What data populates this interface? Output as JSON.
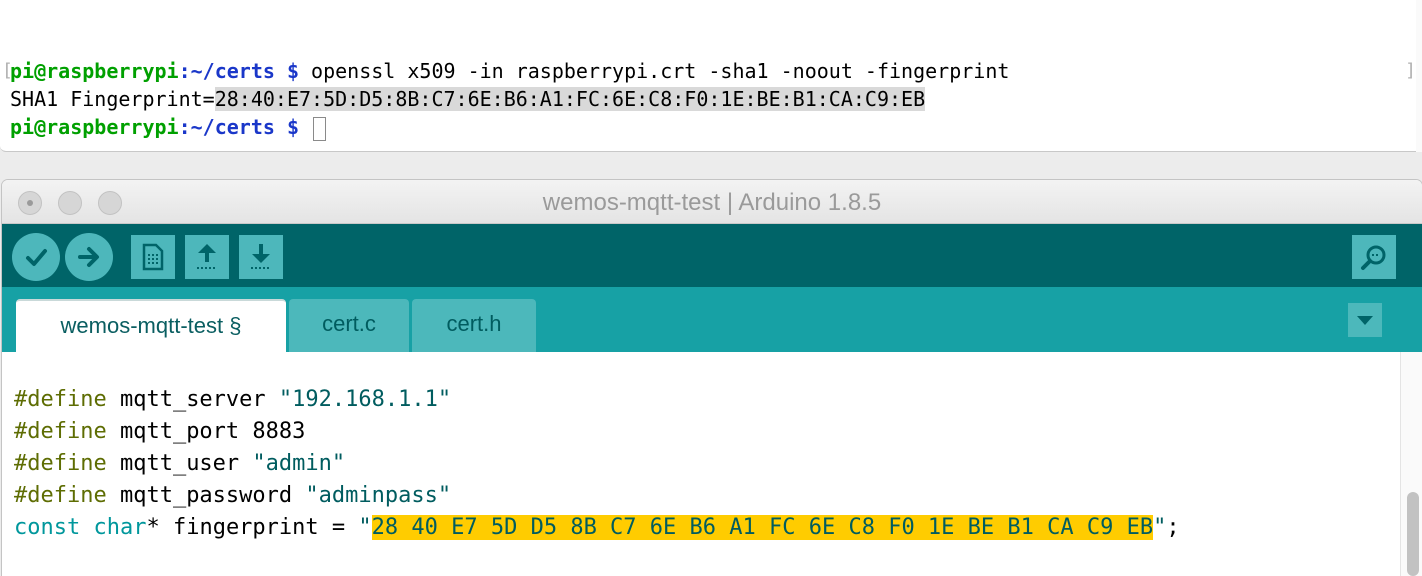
{
  "terminal": {
    "line1": {
      "user": "pi@raspberrypi",
      "path": ":~/certs",
      "dollar": " $ ",
      "command": "openssl x509 -in raspberrypi.crt -sha1 -noout -fingerprint"
    },
    "line2": {
      "label": "SHA1 Fingerprint=",
      "value": "28:40:E7:5D:D5:8B:C7:6E:B6:A1:FC:6E:C8:F0:1E:BE:B1:CA:C9:EB"
    },
    "line3": {
      "user": "pi@raspberrypi",
      "path": ":~/certs",
      "dollar": " $ "
    },
    "bracket_left": "[",
    "bracket_right": "]"
  },
  "arduino": {
    "title": "wemos-mqtt-test | Arduino 1.8.5",
    "toolbar": {
      "verify_icon": "check-icon",
      "upload_icon": "arrow-right-icon",
      "new_icon": "new-file-icon",
      "open_icon": "arrow-up-icon",
      "save_icon": "arrow-down-icon",
      "monitor_icon": "serial-monitor-icon"
    },
    "tabs": [
      {
        "label": "wemos-mqtt-test §",
        "active": true
      },
      {
        "label": "cert.c",
        "active": false
      },
      {
        "label": "cert.h",
        "active": false
      }
    ],
    "code": {
      "l1": {
        "kw": "#define",
        "rest": " mqtt_server ",
        "str": "\"192.168.1.1\""
      },
      "l2": {
        "kw": "#define",
        "rest": " mqtt_port 8883"
      },
      "l3": {
        "kw": "#define",
        "rest": " mqtt_user ",
        "str": "\"admin\""
      },
      "l4": {
        "kw": "#define",
        "rest": " mqtt_password ",
        "str": "\"adminpass\""
      },
      "l5": {
        "const": "const",
        "type": "char",
        "rest": "* fingerprint = ",
        "quote_open": "\"",
        "highlighted": "28 40 E7 5D D5 8B C7 6E B6 A1 FC 6E C8 F0 1E BE B1 CA C9 EB",
        "quote_close": "\"",
        "end": ";"
      }
    },
    "colors": {
      "toolbar": "#006468",
      "tabbar": "#17a1a5",
      "button": "#4db7bb",
      "highlight": "#ffcc00"
    }
  }
}
